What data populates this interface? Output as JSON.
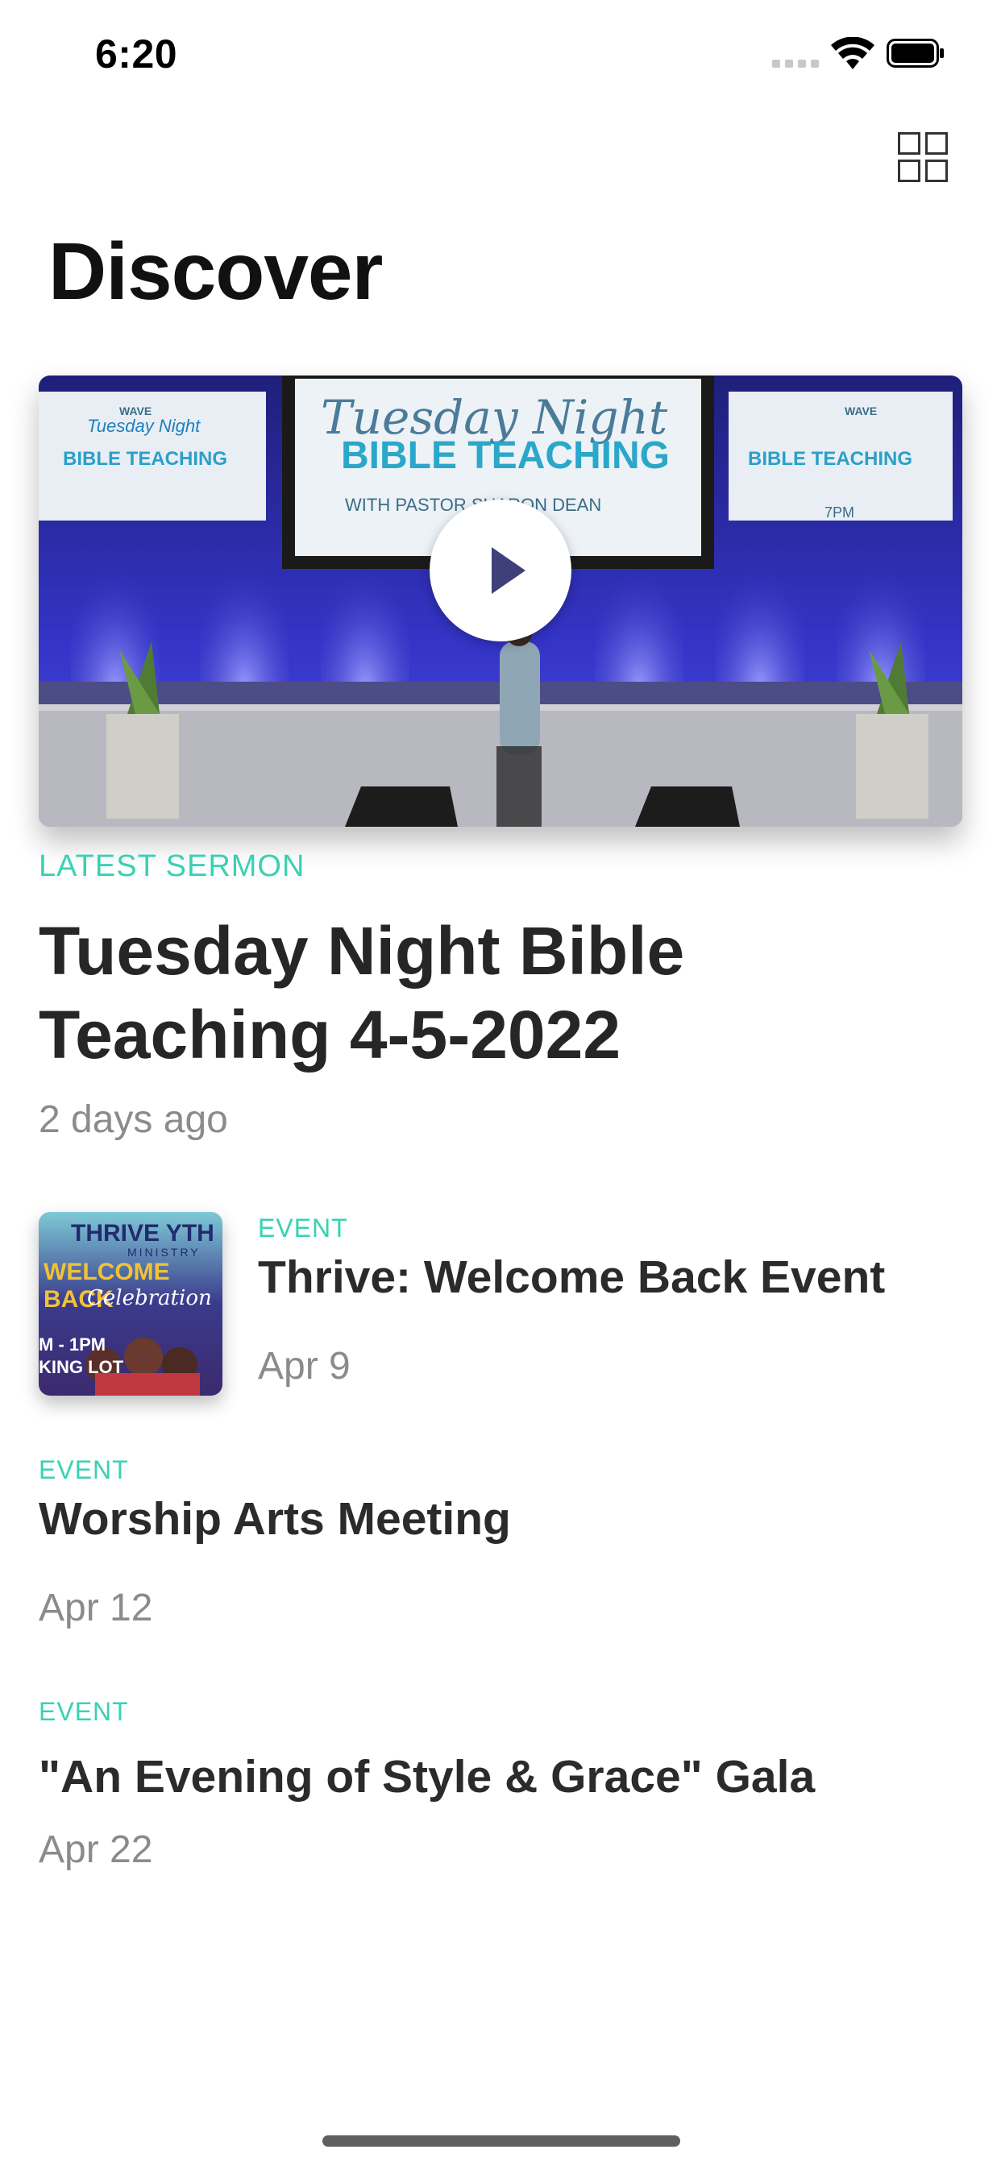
{
  "status_bar": {
    "time": "6:20"
  },
  "header": {
    "title": "Discover"
  },
  "hero": {
    "screen_title": "Tuesday Night",
    "screen_subtitle": "BIBLE TEACHING",
    "screen_host": "WITH PASTOR SHARON DEAN",
    "screen_time": "7PM",
    "screen_logo": "WAVE",
    "category": "LATEST SERMON",
    "title": "Tuesday Night Bible Teaching 4-5-2022",
    "date": "2 days ago"
  },
  "events": [
    {
      "category": "EVENT",
      "title": "Thrive: Welcome Back Event",
      "date": "Apr 9",
      "thumb": {
        "line1": "THRIVE YTH",
        "line2": "MINISTRY",
        "line3": "WELCOME BACK",
        "line4": "Celebration",
        "line5": "M - 1PM",
        "line6": "KING LOT"
      }
    },
    {
      "category": "EVENT",
      "title": "Worship Arts Meeting",
      "date": "Apr 12"
    },
    {
      "category": "EVENT",
      "title": "\"An Evening of Style & Grace\" Gala",
      "date": "Apr 22"
    }
  ],
  "colors": {
    "accent": "#39d1b4",
    "stage_blue": "#3a3adb",
    "text_dark": "#262626",
    "text_gray": "#8b8b8b"
  },
  "icons": {
    "layout": "grid-icon",
    "play": "play-icon",
    "wifi": "wifi-icon",
    "battery": "battery-icon"
  }
}
